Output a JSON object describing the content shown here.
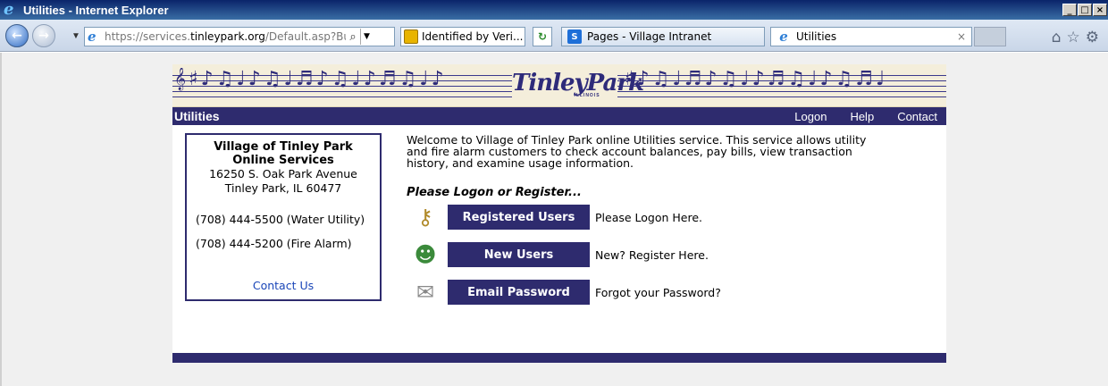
{
  "window": {
    "title": "Utilities - Internet Explorer",
    "min_symbol": "_",
    "max_symbol": "□",
    "close_symbol": "×"
  },
  "toolbar": {
    "back_glyph": "←",
    "forward_glyph": "→",
    "url_scheme": "https://services.",
    "url_domain": "tinleypark.org",
    "url_path": "/Default.asp?Build=",
    "security_label": "Identified by Veri...",
    "tabs": [
      {
        "label": "Pages - Village Intranet",
        "icon": "sharepoint-icon"
      },
      {
        "label": "Utilities",
        "icon": "ie-page-icon",
        "close": "×"
      }
    ],
    "icons": [
      "home-icon",
      "favorites-star-icon",
      "tools-gear-icon"
    ]
  },
  "site": {
    "logo_text": "TinleyPark",
    "logo_sub": "ILLINOIS",
    "section_title": "Utilities",
    "nav": [
      "Logon",
      "Help",
      "Contact"
    ]
  },
  "info_box": {
    "org_line1": "Village of Tinley Park",
    "org_line2": "Online Services",
    "address_line1": "16250 S. Oak Park Avenue",
    "address_line2": "Tinley Park, IL 60477",
    "phone_water": "(708) 444-5500  (Water Utility)",
    "phone_fire": "(708) 444-5200  (Fire Alarm)",
    "contact_link": "Contact Us"
  },
  "main": {
    "welcome": "Welcome to Village of Tinley Park online Utilities service. This service allows utility and fire alarm customers to check account balances, pay bills, view transaction history, and examine usage information.",
    "prompt": "Please Logon or Register...",
    "actions": [
      {
        "button": "Registered Users",
        "text": "Please Logon Here.",
        "icon": "keys-icon"
      },
      {
        "button": "New Users",
        "text": "New? Register Here.",
        "icon": "user-icon"
      },
      {
        "button": "Email Password",
        "text": "Forgot your Password?",
        "icon": "email-envelope-icon"
      }
    ]
  },
  "colors": {
    "brand_navy": "#2e2b6e",
    "link_blue": "#1a46b8",
    "banner_cream": "#f4eedb"
  }
}
